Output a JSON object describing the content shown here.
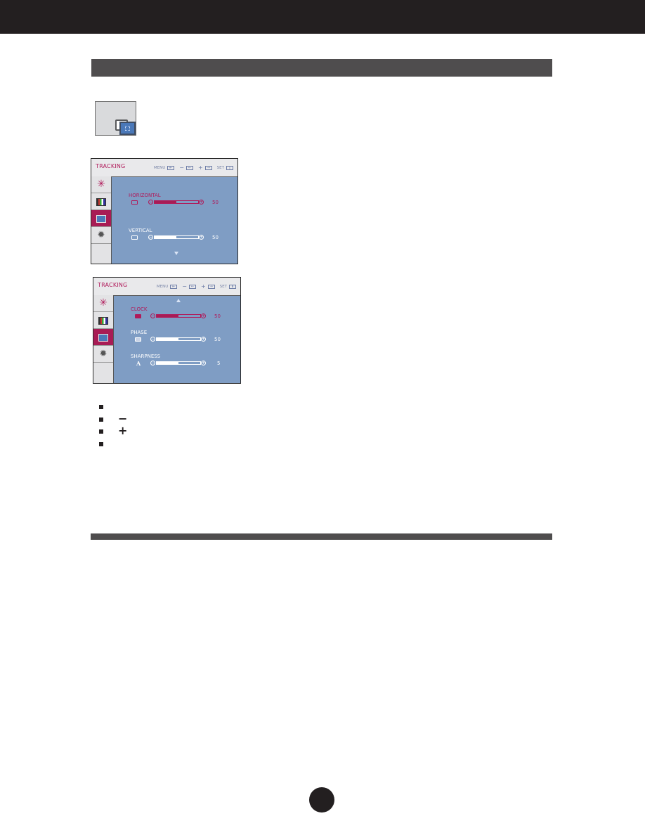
{
  "header": {
    "bar": "top-banner"
  },
  "section": {
    "title": ""
  },
  "menu_icon": {
    "name": "tracking-icon"
  },
  "osd_panels": [
    {
      "title": "TRACKING",
      "keys": {
        "menu": "MENU",
        "minus": "−",
        "plus": "+",
        "set": "SET"
      },
      "sidebar": [
        {
          "icon": "brightness-icon",
          "selected": false
        },
        {
          "icon": "color-icon",
          "selected": false
        },
        {
          "icon": "tracking-icon",
          "selected": true
        },
        {
          "icon": "setup-gear-icon",
          "selected": false
        }
      ],
      "rows": [
        {
          "label": "HORIZONTAL",
          "value": "50",
          "percent": 50,
          "active": true
        },
        {
          "label": "VERTICAL",
          "value": "50",
          "percent": 50,
          "active": false
        }
      ],
      "scroll_arrow": "down"
    },
    {
      "title": "TRACKING",
      "keys": {
        "menu": "MENU",
        "minus": "−",
        "plus": "+",
        "set": "SET"
      },
      "sidebar": [
        {
          "icon": "brightness-icon",
          "selected": false
        },
        {
          "icon": "color-icon",
          "selected": false
        },
        {
          "icon": "tracking-icon",
          "selected": true
        },
        {
          "icon": "setup-gear-icon",
          "selected": false
        }
      ],
      "rows": [
        {
          "label": "CLOCK",
          "value": "50",
          "percent": 50,
          "active": true
        },
        {
          "label": "PHASE",
          "value": "50",
          "percent": 50,
          "active": false
        },
        {
          "label": "SHARPNESS",
          "value": "5",
          "percent": 50,
          "active": false
        }
      ],
      "scroll_arrow": "up"
    }
  ],
  "bullets": [
    {
      "glyph": ""
    },
    {
      "glyph": "−"
    },
    {
      "glyph": "+"
    },
    {
      "glyph": ""
    }
  ],
  "colors": {
    "accent": "#b01a5a",
    "panel": "#7f9dc4",
    "bar": "#4f4d4e",
    "banner": "#231f20"
  }
}
